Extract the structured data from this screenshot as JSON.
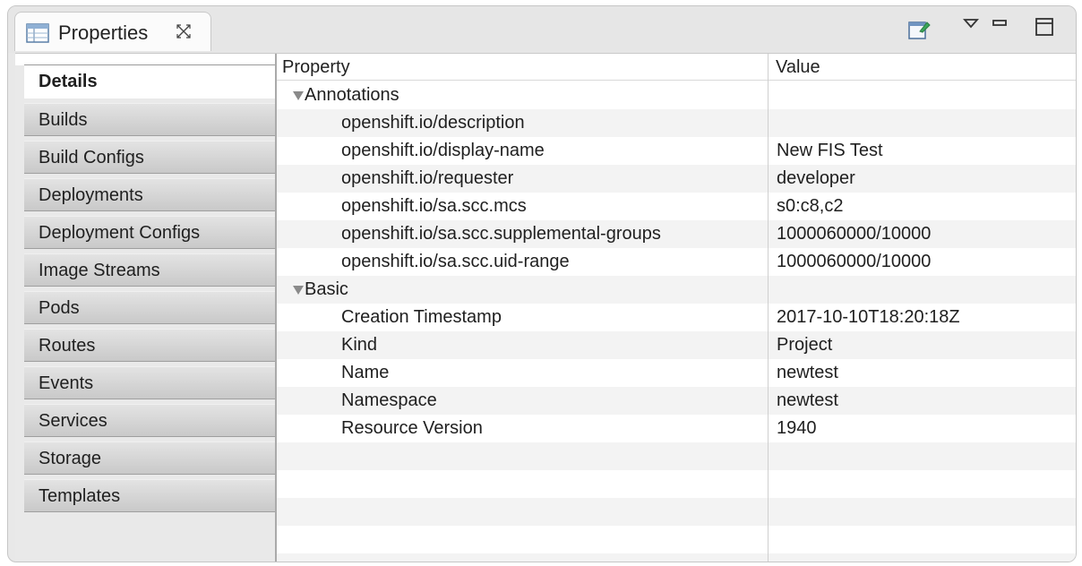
{
  "tab": {
    "title": "Properties",
    "icon": "table-icon",
    "close_icon": "close-icon"
  },
  "toolbar": {
    "icons": [
      "pin-icon",
      "view-menu-icon",
      "minimize-icon",
      "maximize-icon"
    ]
  },
  "nav": {
    "active_index": 0,
    "items": [
      "Details",
      "Builds",
      "Build Configs",
      "Deployments",
      "Deployment Configs",
      "Image Streams",
      "Pods",
      "Routes",
      "Events",
      "Services",
      "Storage",
      "Templates"
    ]
  },
  "table": {
    "headers": {
      "property": "Property",
      "value": "Value"
    },
    "groups": [
      {
        "name": "Annotations",
        "expanded": true,
        "rows": [
          {
            "property": "openshift.io/description",
            "value": ""
          },
          {
            "property": "openshift.io/display-name",
            "value": "New FIS Test"
          },
          {
            "property": "openshift.io/requester",
            "value": "developer"
          },
          {
            "property": "openshift.io/sa.scc.mcs",
            "value": "s0:c8,c2"
          },
          {
            "property": "openshift.io/sa.scc.supplemental-groups",
            "value": "1000060000/10000"
          },
          {
            "property": "openshift.io/sa.scc.uid-range",
            "value": "1000060000/10000"
          }
        ]
      },
      {
        "name": "Basic",
        "expanded": true,
        "rows": [
          {
            "property": "Creation Timestamp",
            "value": "2017-10-10T18:20:18Z"
          },
          {
            "property": "Kind",
            "value": "Project"
          },
          {
            "property": "Name",
            "value": "newtest"
          },
          {
            "property": "Namespace",
            "value": "newtest"
          },
          {
            "property": "Resource Version",
            "value": "1940"
          }
        ]
      }
    ]
  },
  "colors": {
    "row_alt": "#f3f3f3",
    "nav_bg": "#c9c9c9",
    "accent_green": "#3aa55a"
  }
}
